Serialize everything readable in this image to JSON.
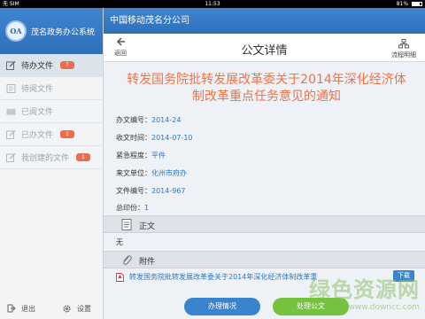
{
  "status": {
    "carrier": "无 SIM",
    "time": "11:53",
    "battery": "81%"
  },
  "app": {
    "name": "茂名政务办公系统",
    "logo_text": "OA",
    "org": "中国移动茂名分公司"
  },
  "sidebar": {
    "items": [
      {
        "label": "待办文件",
        "badge": "7",
        "active": true
      },
      {
        "label": "待阅文件"
      },
      {
        "label": "已阅文件"
      },
      {
        "label": "已办文件",
        "badge": "1"
      },
      {
        "label": "我创建的文件",
        "badge": "1"
      }
    ],
    "logout": "退出",
    "settings": "设置"
  },
  "toolbar": {
    "back": "返回",
    "title": "公文详情",
    "flow": "流程明细"
  },
  "doc": {
    "title": "转发国务院批转发展改革委关于2014年深化经济体制改革重点任务意见的通知",
    "fields": [
      {
        "label": "办文编号：",
        "value": "2014-24"
      },
      {
        "label": "收文时间：",
        "value": "2014-07-10"
      },
      {
        "label": "紧急程度：",
        "value": "平件"
      },
      {
        "label": "来文单位：",
        "value": "化州市府办"
      },
      {
        "label": "文件编号：",
        "value": "2014-967"
      },
      {
        "label": "总印份：",
        "value": "1"
      }
    ],
    "body_section": "正文",
    "body_text": "无",
    "attach_section": "附件",
    "attachment": "转发国务院批转发展改革委关于2014年深化经济体制改革重",
    "download": "下载"
  },
  "actions": {
    "status": "办理情况",
    "process": "处理公文"
  },
  "watermark": {
    "line1": "绿色资源网",
    "line2": "www.downcc.com"
  },
  "colors": {
    "accent": "#3a84cf",
    "title": "#ef7248",
    "badge": "#f06a4c",
    "process": "#74c23e"
  }
}
